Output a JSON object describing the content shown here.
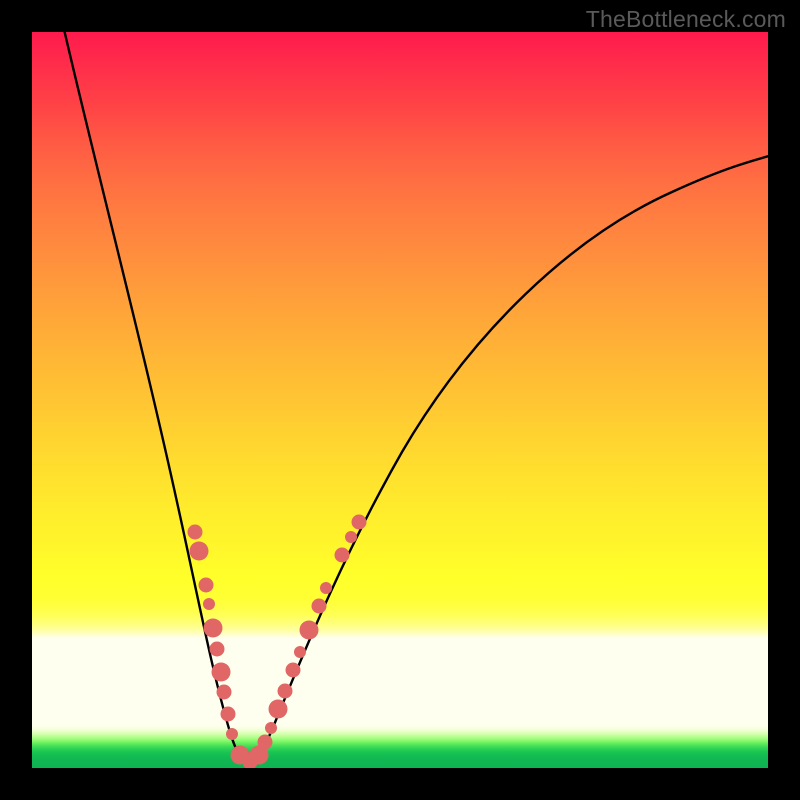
{
  "watermark": "TheBottleneck.com",
  "chart_data": {
    "type": "line",
    "title": "",
    "xlabel": "",
    "ylabel": "",
    "xlim": [
      0,
      100
    ],
    "ylim": [
      0,
      100
    ],
    "series": [
      {
        "name": "bottleneck-curve",
        "x": [
          3,
          5,
          8,
          11,
          15,
          18,
          20,
          22,
          24,
          25,
          26,
          27,
          28,
          29,
          30,
          31,
          33,
          36,
          40,
          45,
          52,
          60,
          70,
          82,
          95,
          100
        ],
        "y": [
          100,
          90,
          75,
          60,
          42,
          30,
          22,
          14,
          8,
          4,
          2,
          1,
          0,
          0,
          1,
          3,
          7,
          15,
          24,
          33,
          42,
          50,
          57,
          63,
          68,
          70
        ]
      }
    ],
    "markers": [
      {
        "name": "left-cluster",
        "x_range": [
          20,
          26
        ],
        "y_range": [
          2,
          35
        ]
      },
      {
        "name": "right-cluster",
        "x_range": [
          28,
          38
        ],
        "y_range": [
          1,
          33
        ]
      },
      {
        "name": "bottom-cluster",
        "x_range": [
          25,
          29
        ],
        "y_range": [
          0,
          3
        ]
      }
    ],
    "background_gradient": {
      "top": "#ff1a4d",
      "mid": "#fff62b",
      "pale_band": "#fffff0",
      "bottom": "#0fb452"
    },
    "frame_color": "#000000",
    "curve_color": "#000000",
    "marker_color": "#e06766"
  }
}
